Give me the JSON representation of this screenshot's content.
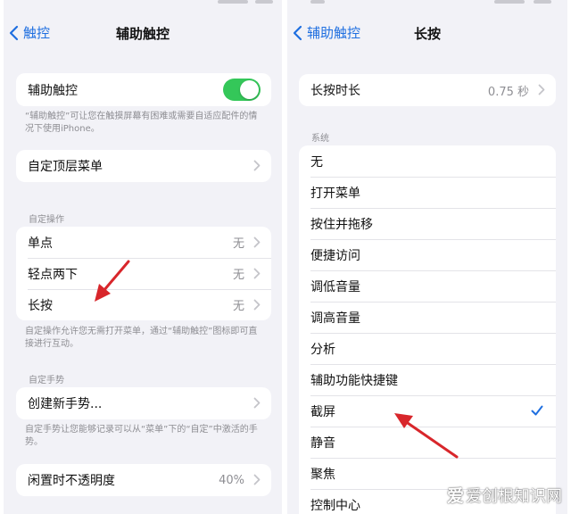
{
  "left": {
    "nav": {
      "back_label": "触控",
      "title": "辅助触控"
    },
    "assistive_touch_label": "辅助触控",
    "assistive_touch_note": "“辅助触控”可让您在触摸屏幕有困难或需要自适应配件的情况下使用iPhone。",
    "top_menu_label": "自定顶层菜单",
    "custom_actions_header": "自定操作",
    "actions": [
      {
        "label": "单点",
        "value": "无"
      },
      {
        "label": "轻点两下",
        "value": "无"
      },
      {
        "label": "长按",
        "value": "无"
      }
    ],
    "actions_note": "自定操作允许您无需打开菜单，通过“辅助触控”图标即可直接进行互动。",
    "custom_gestures_header": "自定手势",
    "new_gesture_label": "创建新手势...",
    "gestures_note": "自定手势让您能够记录可以从“菜单”下的“自定”中激活的手势。",
    "idle_opacity_label": "闲置时不透明度",
    "idle_opacity_value": "40%"
  },
  "right": {
    "nav": {
      "back_label": "辅助触控",
      "title": "长按"
    },
    "duration_label": "长按时长",
    "duration_value": "0.75 秒",
    "system_header": "系统",
    "options": [
      {
        "label": "无",
        "checked": false
      },
      {
        "label": "打开菜单",
        "checked": false
      },
      {
        "label": "按住并拖移",
        "checked": false
      },
      {
        "label": "便捷访问",
        "checked": false
      },
      {
        "label": "调低音量",
        "checked": false
      },
      {
        "label": "调高音量",
        "checked": false
      },
      {
        "label": "分析",
        "checked": false
      },
      {
        "label": "辅助功能快捷键",
        "checked": false
      },
      {
        "label": "截屏",
        "checked": true
      },
      {
        "label": "静音",
        "checked": false
      },
      {
        "label": "聚焦",
        "checked": false
      },
      {
        "label": "控制中心",
        "checked": false
      }
    ]
  },
  "watermark": {
    "logo": "爱",
    "text": "爱创根知识网"
  },
  "colors": {
    "accent": "#1f6fe0",
    "toggle_on": "#34c759",
    "arrow": "#d8262b",
    "background": "#f2f2f7"
  }
}
